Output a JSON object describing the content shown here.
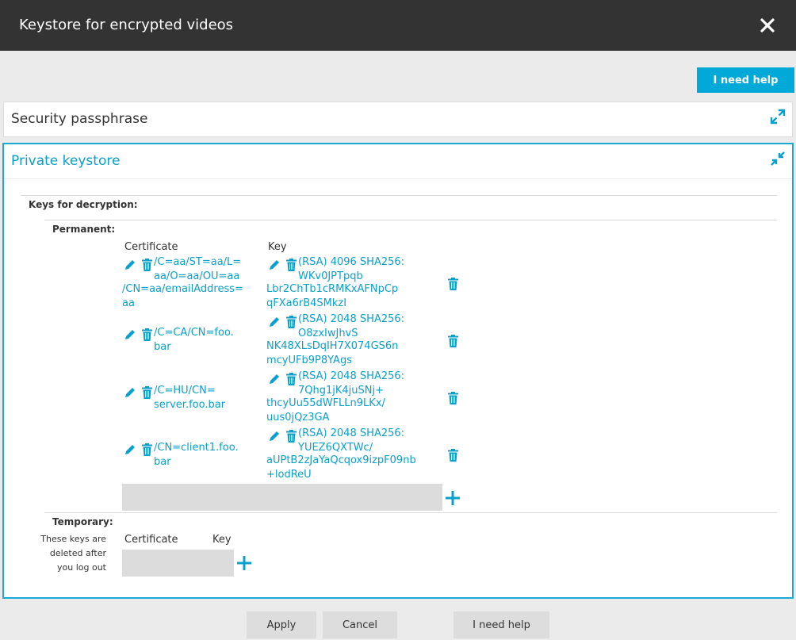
{
  "dialog": {
    "title": "Keystore for encrypted videos",
    "help_label": "I need help"
  },
  "sections": {
    "security": {
      "title": "Security passphrase"
    },
    "private": {
      "title": "Private keystore"
    }
  },
  "keys": {
    "label": "Keys for decryption:",
    "permanent": {
      "label": "Permanent:",
      "col_certificate": "Certificate",
      "col_key": "Key",
      "rows": [
        {
          "cert_lines": [
            "/C=aa/ST=aa/L=",
            "aa/O=aa/OU=aa",
            "/CN=aa/emailAddress=",
            "aa"
          ],
          "key_lines": [
            "(RSA) 4096 SHA256:",
            "WKv0JPTpqb",
            "Lbr2ChTb1cRMKxAFNpCp",
            "qFXa6rB4SMkzI"
          ]
        },
        {
          "cert_lines": [
            "/C=CA/CN=foo.",
            "bar"
          ],
          "key_lines": [
            "(RSA) 2048 SHA256:",
            "O8zxIwJhvS",
            "NK48XLsDqIH7X074GS6n",
            "mcyUFb9P8YAgs"
          ]
        },
        {
          "cert_lines": [
            "/C=HU/CN=",
            "server.foo.bar"
          ],
          "key_lines": [
            "(RSA) 2048 SHA256:",
            "7Qhg1jK4juSNj+",
            "thcyUu55dWFLLn9LKx/",
            "uus0jQz3GA"
          ]
        },
        {
          "cert_lines": [
            "/CN=client1.foo.",
            "bar"
          ],
          "key_lines": [
            "(RSA) 2048 SHA256:",
            "YUEZ6QXTWc/",
            "aUPtB2zJaYaQcqox9izpF09nb",
            "+lodReU"
          ]
        }
      ]
    },
    "temporary": {
      "label": "Temporary:",
      "note_lines": [
        "These keys are",
        "deleted after",
        "you log out"
      ],
      "col_certificate": "Certificate",
      "col_key": "Key"
    }
  },
  "footer": {
    "apply_label": "Apply",
    "cancel_label": "Cancel",
    "help_label": "I need help"
  },
  "colors": {
    "accent": "#00a9d8",
    "header_bg": "#333333",
    "link": "#0aa0cb"
  }
}
